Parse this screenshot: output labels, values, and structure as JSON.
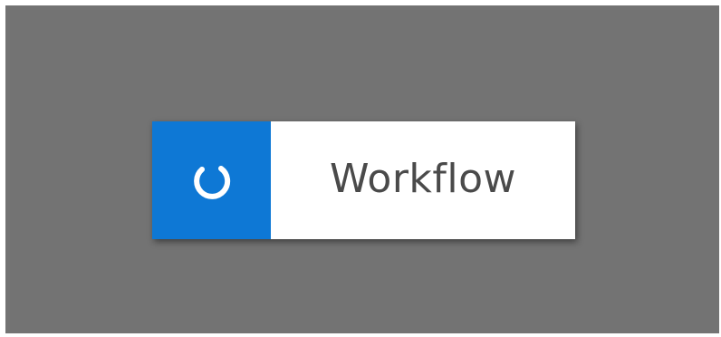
{
  "tile": {
    "label": "Workflow",
    "icon": "loading-spinner-icon",
    "accent_color": "#0e78d5",
    "background_color": "#737373"
  }
}
